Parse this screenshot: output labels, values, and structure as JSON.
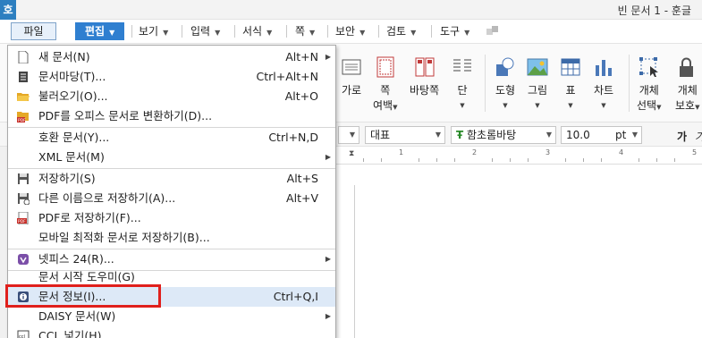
{
  "titlebar": {
    "app_icon": "호",
    "title": "빈 문서 1 - 훈글"
  },
  "menubar": {
    "items": [
      {
        "label": "파일"
      },
      {
        "label": "편집"
      },
      {
        "label": "보기"
      },
      {
        "label": "입력"
      },
      {
        "label": "서식"
      },
      {
        "label": "쪽"
      },
      {
        "label": "보안"
      },
      {
        "label": "검토"
      },
      {
        "label": "도구"
      }
    ]
  },
  "ribbon": {
    "buttons": [
      {
        "label": "가로",
        "sub": ""
      },
      {
        "label": "쪽",
        "sub": "여백"
      },
      {
        "label": "바탕쪽",
        "sub": ""
      },
      {
        "label": "단",
        "sub": ""
      },
      {
        "label": "도형",
        "sub": ""
      },
      {
        "label": "그림",
        "sub": ""
      },
      {
        "label": "표",
        "sub": ""
      },
      {
        "label": "차트",
        "sub": ""
      },
      {
        "label": "개체",
        "sub": "선택"
      },
      {
        "label": "개체",
        "sub": "보호"
      }
    ]
  },
  "formatbar": {
    "style": "대표",
    "font": "함초롬바탕",
    "size": "10.0",
    "unit": "pt",
    "bold": "가",
    "italic": "가"
  },
  "ruler": {
    "labels": [
      "1",
      "2",
      "3",
      "4",
      "5"
    ]
  },
  "file_menu": {
    "items": [
      {
        "label": "새 문서(N)",
        "shortcut": "Alt+N",
        "submenu": true,
        "icon": "new-document-icon"
      },
      {
        "label": "문서마당(T)...",
        "shortcut": "Ctrl+Alt+N",
        "submenu": false,
        "icon": "document-template-icon"
      },
      {
        "label": "불러오기(O)...",
        "shortcut": "Alt+O",
        "submenu": false,
        "icon": "open-folder-icon"
      },
      {
        "label": "PDF를 오피스 문서로 변환하기(D)...",
        "shortcut": "",
        "submenu": false,
        "icon": "pdf-convert-icon"
      },
      {
        "label": "호환 문서(Y)...",
        "shortcut": "Ctrl+N,D",
        "submenu": false,
        "icon": ""
      },
      {
        "label": "XML 문서(M)",
        "shortcut": "",
        "submenu": true,
        "icon": ""
      },
      {
        "label": "저장하기(S)",
        "shortcut": "Alt+S",
        "submenu": false,
        "icon": "save-icon"
      },
      {
        "label": "다른 이름으로 저장하기(A)...",
        "shortcut": "Alt+V",
        "submenu": false,
        "icon": "save-as-icon"
      },
      {
        "label": "PDF로 저장하기(F)...",
        "shortcut": "",
        "submenu": false,
        "icon": "pdf-save-icon"
      },
      {
        "label": "모바일 최적화 문서로 저장하기(B)...",
        "shortcut": "",
        "submenu": false,
        "icon": ""
      },
      {
        "label": "넷피스 24(R)...",
        "shortcut": "",
        "submenu": true,
        "icon": "netffice-icon"
      },
      {
        "label": "문서 시작 도우미(G)",
        "shortcut": "",
        "submenu": false,
        "icon": ""
      },
      {
        "label": "문서 정보(I)...",
        "shortcut": "Ctrl+Q,I",
        "submenu": false,
        "icon": "info-icon"
      },
      {
        "label": "DAISY 문서(W)",
        "shortcut": "",
        "submenu": true,
        "icon": ""
      },
      {
        "label": "CCL 넣기(H)...",
        "shortcut": "",
        "submenu": false,
        "icon": "ccl-icon"
      }
    ]
  },
  "colors": {
    "accent": "#2f7fd0",
    "highlight": "#e0201c"
  }
}
